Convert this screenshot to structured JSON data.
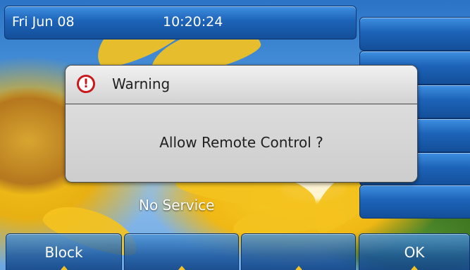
{
  "status_bar": {
    "date": "Fri Jun 08",
    "time": "10:20:24"
  },
  "line_keys": [
    "",
    "",
    "",
    "",
    "",
    ""
  ],
  "dialog": {
    "title": "Warning",
    "message": "Allow Remote Control ?",
    "icon": "warning-icon",
    "icon_glyph": "!",
    "icon_color": "#c9191b"
  },
  "idle": {
    "status_text": "No Service"
  },
  "softkeys": [
    {
      "label": "Block"
    },
    {
      "label": ""
    },
    {
      "label": ""
    },
    {
      "label": "OK"
    }
  ],
  "colors": {
    "accent_blue": "#1d63b8",
    "warning_red": "#c9191b",
    "highlight_yellow": "#f4c21e"
  }
}
